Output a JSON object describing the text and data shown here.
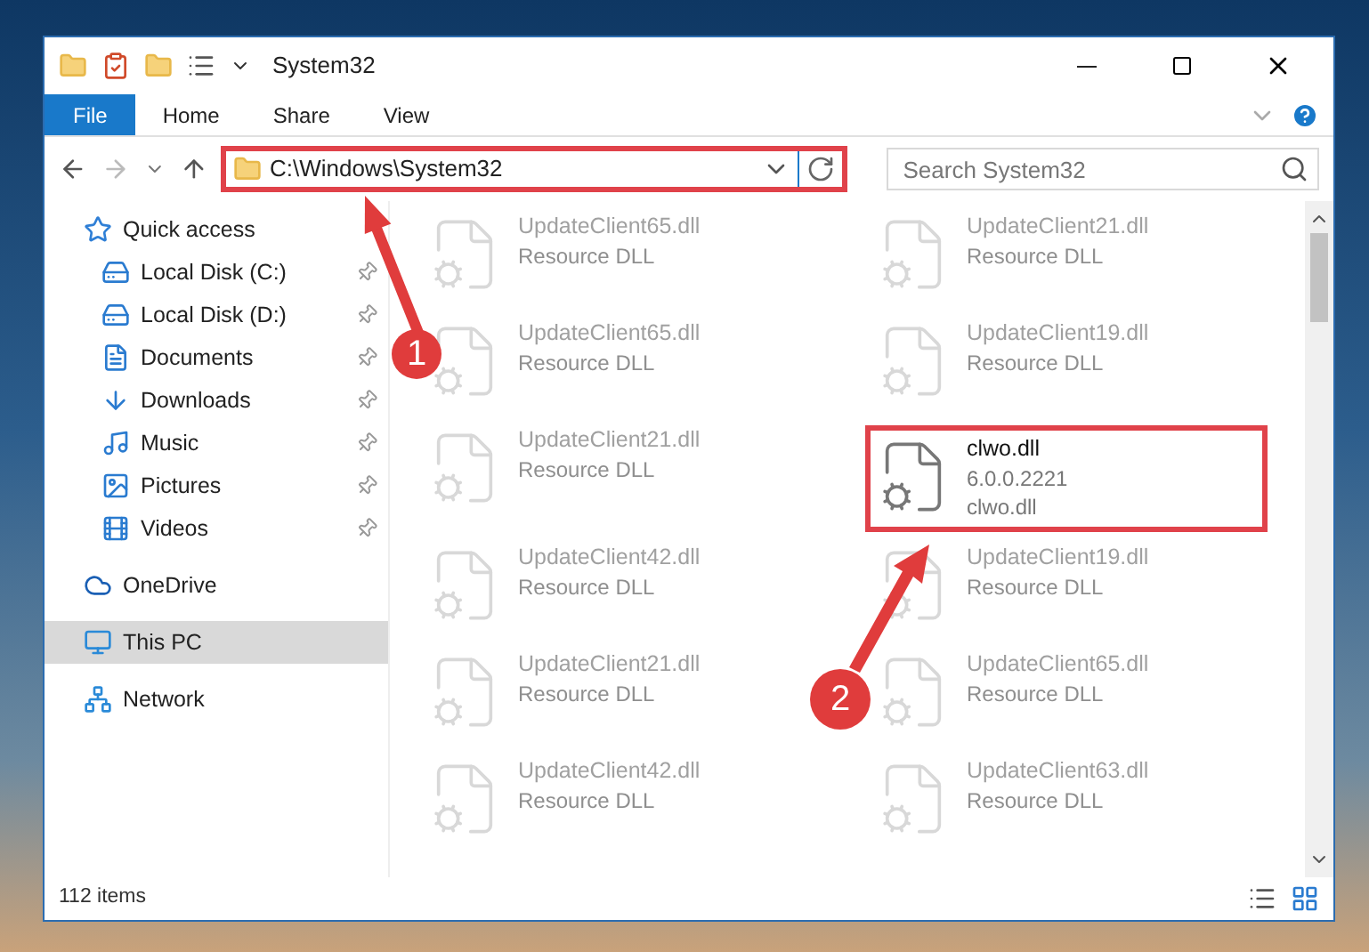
{
  "window": {
    "title": "System32"
  },
  "ribbon": {
    "tabs": [
      {
        "label": "File",
        "kind": "menu"
      },
      {
        "label": "Home",
        "kind": "tab"
      },
      {
        "label": "Share",
        "kind": "tab"
      },
      {
        "label": "View",
        "kind": "tab"
      }
    ]
  },
  "address_bar": {
    "path": "C:\\Windows\\System32",
    "highlighted": true
  },
  "search": {
    "placeholder": "Search System32"
  },
  "sidebar": {
    "items": [
      {
        "label": "Quick access",
        "selected": false,
        "children": [
          {
            "label": "Local Disk (C:)",
            "pinned": true
          },
          {
            "label": "Local Disk (D:)",
            "pinned": true
          },
          {
            "label": "Documents",
            "pinned": true
          },
          {
            "label": "Downloads",
            "pinned": true
          },
          {
            "label": "Music",
            "pinned": true
          },
          {
            "label": "Pictures",
            "pinned": true
          },
          {
            "label": "Videos",
            "pinned": true
          }
        ]
      },
      {
        "label": "OneDrive",
        "selected": false
      },
      {
        "label": "This PC",
        "selected": true
      },
      {
        "label": "Network",
        "selected": false
      }
    ]
  },
  "files": [
    {
      "name": "UpdateClient65.dll",
      "lines": [
        "Resource DLL"
      ],
      "highlighted": false
    },
    {
      "name": "UpdateClient21.dll",
      "lines": [
        "Resource DLL"
      ],
      "highlighted": false
    },
    {
      "name": "UpdateClient65.dll",
      "lines": [
        "Resource DLL"
      ],
      "highlighted": false
    },
    {
      "name": "UpdateClient19.dll",
      "lines": [
        "Resource DLL"
      ],
      "highlighted": false
    },
    {
      "name": "UpdateClient21.dll",
      "lines": [
        "Resource DLL"
      ],
      "highlighted": false
    },
    {
      "name": "clwo.dll",
      "lines": [
        "6.0.0.2221",
        "clwo.dll"
      ],
      "highlighted": true
    },
    {
      "name": "UpdateClient42.dll",
      "lines": [
        "Resource DLL"
      ],
      "highlighted": false
    },
    {
      "name": "UpdateClient19.dll",
      "lines": [
        "Resource DLL"
      ],
      "highlighted": false
    },
    {
      "name": "UpdateClient21.dll",
      "lines": [
        "Resource DLL"
      ],
      "highlighted": false
    },
    {
      "name": "UpdateClient65.dll",
      "lines": [
        "Resource DLL"
      ],
      "highlighted": false
    },
    {
      "name": "UpdateClient42.dll",
      "lines": [
        "Resource DLL"
      ],
      "highlighted": false
    },
    {
      "name": "UpdateClient63.dll",
      "lines": [
        "Resource DLL"
      ],
      "highlighted": false
    }
  ],
  "status_bar": {
    "count": "112 items"
  },
  "annotations": [
    {
      "label": "1"
    },
    {
      "label": "2"
    }
  ]
}
